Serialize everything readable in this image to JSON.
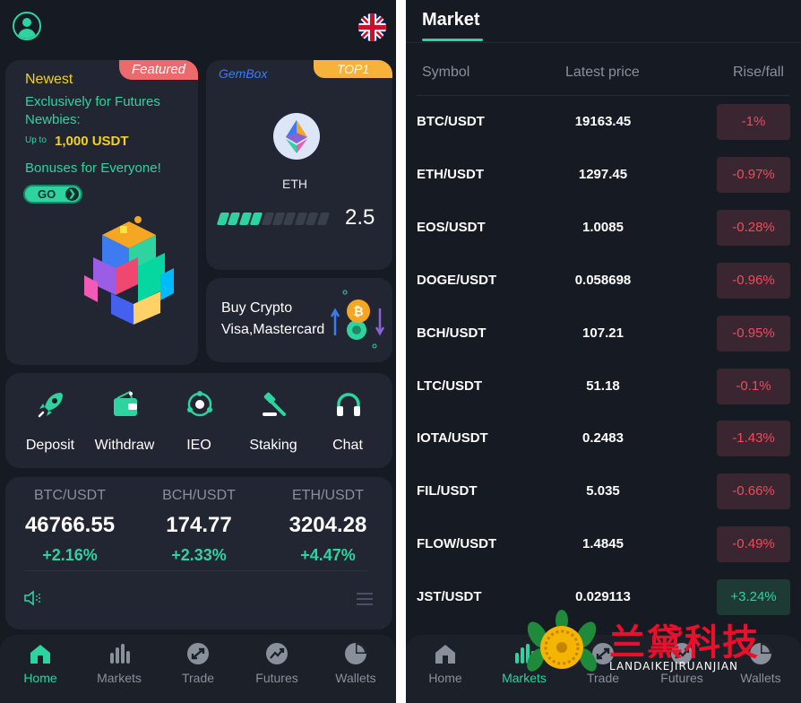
{
  "left": {
    "promo": {
      "tag": "Featured",
      "newest": "Newest",
      "line1": "Exclusively for Futures",
      "line2": "Newbies:",
      "upto": "Up to",
      "amount": "1,000 USDT",
      "line3": "Bonuses for Everyone!",
      "go": "GO"
    },
    "gembox": {
      "label": "GemBox",
      "tag": "TOP1",
      "coin": "ETH",
      "value": "2.5",
      "level": 0.25
    },
    "buy": {
      "line1": "Buy Crypto",
      "line2": "Visa,Mastercard"
    },
    "quick_actions": [
      {
        "label": "Deposit",
        "icon": "rocket-icon"
      },
      {
        "label": "Withdraw",
        "icon": "wallet-icon"
      },
      {
        "label": "IEO",
        "icon": "orbit-icon"
      },
      {
        "label": "Staking",
        "icon": "gavel-icon"
      },
      {
        "label": "Chat",
        "icon": "headphones-icon"
      }
    ],
    "tickers": [
      {
        "pair": "BTC/USDT",
        "price": "46766.55",
        "change": "+2.16%"
      },
      {
        "pair": "BCH/USDT",
        "price": "174.77",
        "change": "+2.33%"
      },
      {
        "pair": "ETH/USDT",
        "price": "3204.28",
        "change": "+4.47%"
      }
    ],
    "tabs": [
      {
        "label": "Home",
        "icon": "home-icon",
        "active": true
      },
      {
        "label": "Markets",
        "icon": "bar-chart-icon",
        "active": false
      },
      {
        "label": "Trade",
        "icon": "trade-icon",
        "active": false
      },
      {
        "label": "Futures",
        "icon": "trend-icon",
        "active": false
      },
      {
        "label": "Wallets",
        "icon": "pie-chart-icon",
        "active": false
      }
    ]
  },
  "right": {
    "title": "Market",
    "columns": {
      "symbol": "Symbol",
      "price": "Latest price",
      "change": "Rise/fall"
    },
    "rows": [
      {
        "symbol": "BTC/USDT",
        "price": "19163.45",
        "change": "-1%",
        "dir": "down"
      },
      {
        "symbol": "ETH/USDT",
        "price": "1297.45",
        "change": "-0.97%",
        "dir": "down"
      },
      {
        "symbol": "EOS/USDT",
        "price": "1.0085",
        "change": "-0.28%",
        "dir": "down"
      },
      {
        "symbol": "DOGE/USDT",
        "price": "0.058698",
        "change": "-0.96%",
        "dir": "down"
      },
      {
        "symbol": "BCH/USDT",
        "price": "107.21",
        "change": "-0.95%",
        "dir": "down"
      },
      {
        "symbol": "LTC/USDT",
        "price": "51.18",
        "change": "-0.1%",
        "dir": "down"
      },
      {
        "symbol": "IOTA/USDT",
        "price": "0.2483",
        "change": "-1.43%",
        "dir": "down"
      },
      {
        "symbol": "FIL/USDT",
        "price": "5.035",
        "change": "-0.66%",
        "dir": "down"
      },
      {
        "symbol": "FLOW/USDT",
        "price": "1.4845",
        "change": "-0.49%",
        "dir": "down"
      },
      {
        "symbol": "JST/USDT",
        "price": "0.029113",
        "change": "+3.24%",
        "dir": "up"
      }
    ],
    "tabs": [
      {
        "label": "Home",
        "icon": "home-icon",
        "active": false
      },
      {
        "label": "Markets",
        "icon": "bar-chart-icon",
        "active": true
      },
      {
        "label": "Trade",
        "icon": "trade-icon",
        "active": false
      },
      {
        "label": "Futures",
        "icon": "trend-icon",
        "active": false
      },
      {
        "label": "Wallets",
        "icon": "pie-chart-icon",
        "active": false
      }
    ]
  },
  "watermark": {
    "cn": "兰黛科技",
    "en": "LANDAIKEJIRUANJIAN"
  },
  "colors": {
    "accent": "#2ed3a0",
    "down": "#ef4b5b",
    "background": "#161a23",
    "card": "#222633"
  }
}
